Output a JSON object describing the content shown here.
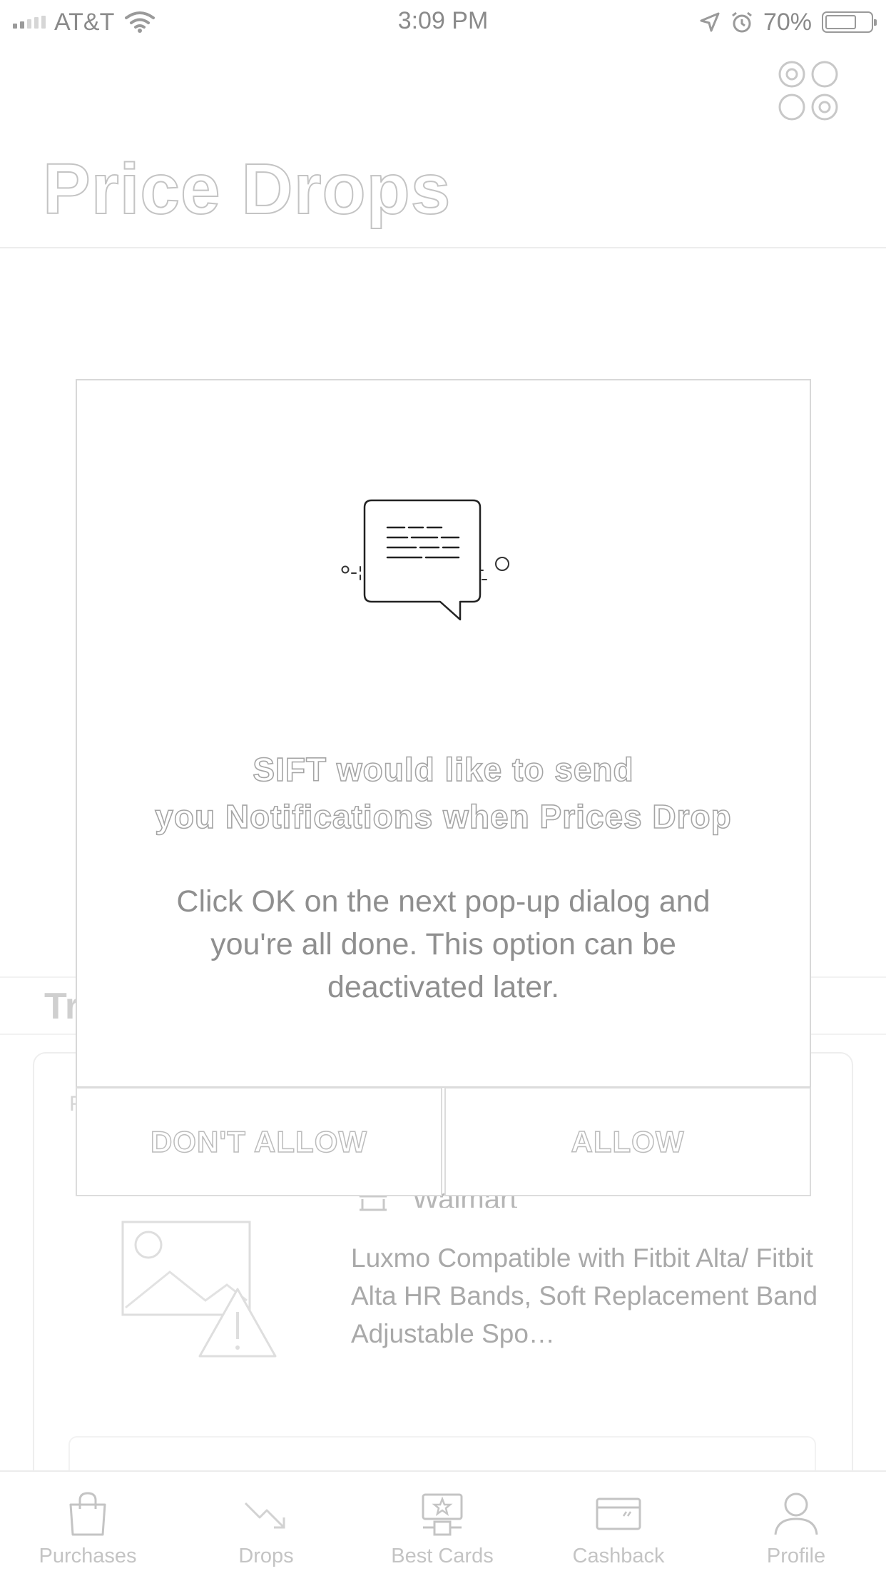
{
  "status_bar": {
    "carrier": "AT&T",
    "time": "3:09 PM",
    "battery": "70%",
    "battery_level": 0.7
  },
  "header": {
    "title": "Price Drops"
  },
  "background": {
    "section_heading": "Tr",
    "card_label": "F",
    "store_name": "Walmart",
    "product_title": "Luxmo Compatible with Fitbit Alta/ Fitbit Alta HR Bands, Soft Replacement Band Adjustable Spo…"
  },
  "modal": {
    "title_line1": "SIFT would like to send",
    "title_line2": "you Notifications when Prices Drop",
    "body": "Click OK on the next pop-up dialog and you're all done. This option can be deactivated later.",
    "deny_label": "DON'T ALLOW",
    "allow_label": "ALLOW"
  },
  "tab_bar": {
    "items": [
      {
        "label": "Purchases",
        "icon": "shopping-bag-icon"
      },
      {
        "label": "Drops",
        "icon": "trending-down-icon"
      },
      {
        "label": "Best Cards",
        "icon": "podium-star-icon"
      },
      {
        "label": "Cashback",
        "icon": "credit-card-icon"
      },
      {
        "label": "Profile",
        "icon": "person-icon"
      }
    ]
  }
}
